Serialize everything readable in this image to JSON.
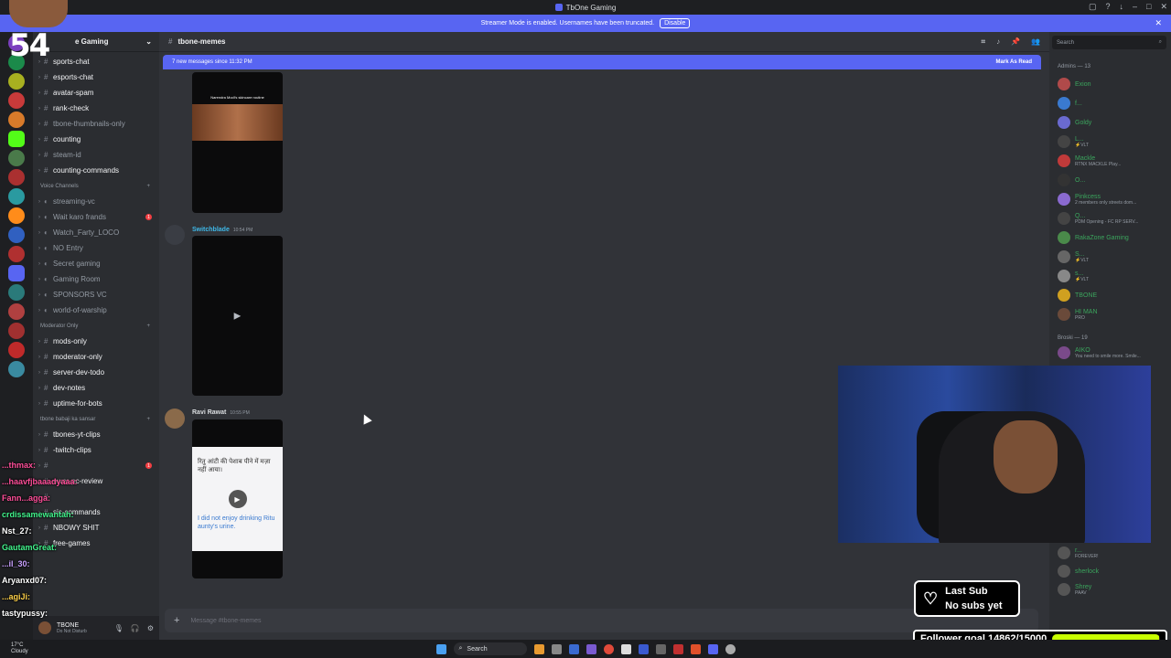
{
  "window": {
    "title": "TbOne Gaming"
  },
  "streamer_bar": {
    "text": "Streamer Mode is enabled. Usernames have been truncated.",
    "disable_label": "Disable"
  },
  "server": {
    "name": "TbOne Gaming",
    "name_visible": "e Gaming"
  },
  "channels": [
    {
      "type": "text",
      "label": "sports-chat"
    },
    {
      "type": "text",
      "label": "esports-chat"
    },
    {
      "type": "text",
      "label": "avatar-spam"
    },
    {
      "type": "text",
      "label": "rank-check"
    },
    {
      "type": "text-muted",
      "label": "tbone-thumbnails-only"
    },
    {
      "type": "text",
      "label": "counting"
    },
    {
      "type": "text-muted",
      "label": "steam-id"
    },
    {
      "type": "text",
      "label": "counting-commands"
    }
  ],
  "voice_category": "Voice Channels",
  "voice_channels": [
    {
      "label": "streaming-vc",
      "badge": ""
    },
    {
      "label": "Wait karo frands",
      "badge": "1"
    },
    {
      "label": "Watch_Farty_LOCO",
      "badge": ""
    },
    {
      "label": "NO Entry",
      "badge": ""
    },
    {
      "label": "Secret gaming",
      "badge": ""
    },
    {
      "label": "Gaming Room",
      "badge": ""
    },
    {
      "label": "SPONSORS VC",
      "badge": ""
    },
    {
      "label": "world-of-warship",
      "badge": ""
    }
  ],
  "mod_category": "Moderator Only",
  "mod_channels": [
    {
      "label": "mods-only"
    },
    {
      "label": "moderator-only"
    },
    {
      "label": "server-dev-todo"
    },
    {
      "label": "dev-notes"
    },
    {
      "label": "uptime-for-bots"
    }
  ],
  "babaji_category": "tbone babaji ka sansar",
  "babaji_channels": [
    {
      "label": "tbones-yt-clips"
    },
    {
      "label": "-twitch-clips"
    },
    {
      "label": "",
      "badge": "1"
    },
    {
      "label": "ewer-pc-review"
    },
    {
      "label": ""
    },
    {
      "label": "sic-commands"
    },
    {
      "label": "NBOWY SHIT"
    },
    {
      "label": "free-games"
    }
  ],
  "userbar": {
    "name": "TBONE",
    "status": "Do Not Disturb"
  },
  "header": {
    "channel": "tbone-memes"
  },
  "new_messages": {
    "text": "7 new messages since 11:32 PM",
    "mark_label": "Mark As Read"
  },
  "messages": [
    {
      "caption": "Narendra Modi's skincare routine"
    },
    {
      "author": "Switchblade",
      "time": "10:54 PM",
      "color": "#3fb8e8"
    },
    {
      "author": "Ravi Rawat",
      "time": "10:55 PM",
      "color": "#dbdee1",
      "hindi": "रितु आंटी की पेशाब पीने में मज़ा नहीं आया।",
      "english": "I did not enjoy drinking Ritu aunty's urine."
    }
  ],
  "composer": {
    "placeholder": "Message #tbone-memes"
  },
  "members": {
    "search_placeholder": "Search",
    "admins_label": "Admins — 13",
    "admins": [
      {
        "name": "Exion",
        "status": "",
        "color": "#3ba55d"
      },
      {
        "name": "f...",
        "status": "",
        "color": "#3ba55d"
      },
      {
        "name": "Goldy",
        "status": "",
        "color": "#3ba55d"
      },
      {
        "name": "L...",
        "status": "⚡VLT",
        "color": "#3ba55d"
      },
      {
        "name": "Mackle",
        "status": "RTNX MACKLE Play...",
        "color": "#3ba55d"
      },
      {
        "name": "O...",
        "status": "",
        "color": "#3ba55d"
      },
      {
        "name": "Pinkcess",
        "status": "2 members only streets dom...",
        "color": "#3ba55d"
      },
      {
        "name": "Q...",
        "status": "PDM Opening - FC RP SERV...",
        "color": "#3ba55d"
      },
      {
        "name": "RakaZone Gaming",
        "status": "",
        "color": "#3ba55d"
      },
      {
        "name": "S...",
        "status": "⚡VLT",
        "color": "#3ba55d"
      },
      {
        "name": "s...",
        "status": "⚡VLT",
        "color": "#3ba55d"
      },
      {
        "name": "TBONE",
        "status": "",
        "color": "#3ba55d"
      },
      {
        "name": "HI MAN",
        "status": "PRO",
        "color": "#3ba55d"
      }
    ],
    "broski_label": "Broski — 19",
    "broski": [
      {
        "name": "AIKO",
        "status": "You need to smile more. Smile..."
      }
    ],
    "bottom": [
      {
        "name": "r...",
        "status": "FOREVER!"
      },
      {
        "name": "sherlock",
        "status": ""
      },
      {
        "name": "Shrey",
        "status": "PAAV"
      }
    ]
  },
  "overlay": {
    "score": "54",
    "last_sub_title": "Last Sub",
    "last_sub_value": "No subs yet",
    "follower_goal": "Follower goal 14862/15000",
    "follower_progress": 0.9908,
    "chat": [
      {
        "user": "...thmax:",
        "color": "#ff4f9a"
      },
      {
        "user": "...haavfjbaaadyaaa:",
        "color": "#ff4f9a"
      },
      {
        "user": "Fann...agga:",
        "color": "#ff4f9a"
      },
      {
        "user": "crdissamewantah:",
        "color": "#42f58d"
      },
      {
        "user": "Nst_27:",
        "color": "#ffffff"
      },
      {
        "user": "GautamGreat:",
        "color": "#42f58d"
      },
      {
        "user": "...il_30:",
        "color": "#c8a0ff"
      },
      {
        "user": "Aryanxd07:",
        "color": "#ffffff"
      },
      {
        "user": "...agiJi:",
        "color": "#ffd24a"
      },
      {
        "user": "tastypussy:",
        "color": "#ffffff"
      }
    ]
  },
  "taskbar": {
    "search_label": "Search",
    "weather_temp": "17°C",
    "weather_desc": "Cloudy"
  }
}
